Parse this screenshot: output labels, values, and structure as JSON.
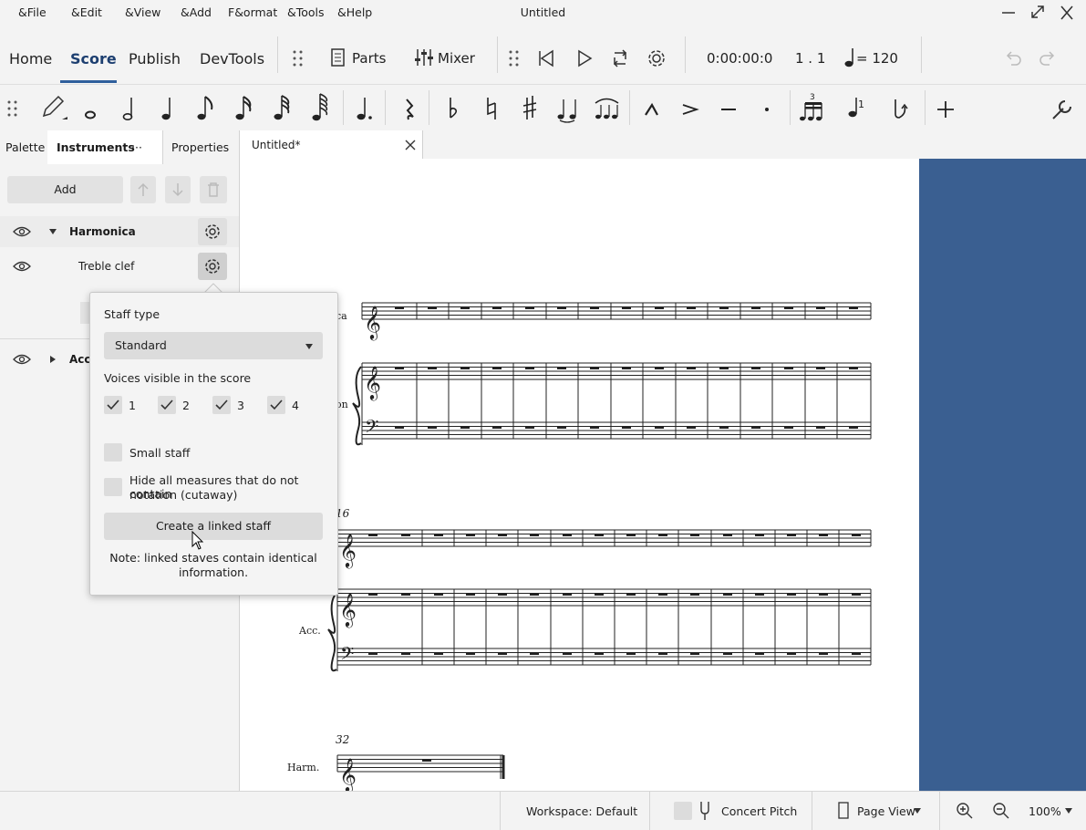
{
  "app": {
    "window_title": "Untitled",
    "menu": [
      "&File",
      "&Edit",
      "&View",
      "&Add",
      "F&ormat",
      "&Tools",
      "&Help"
    ]
  },
  "toolbar": {
    "tabs": [
      "Home",
      "Score",
      "Publish",
      "DevTools"
    ],
    "active_tab": "Score",
    "parts_label": "Parts",
    "mixer_label": "Mixer",
    "time": "0:00:00:0",
    "position": "1 . 1",
    "tempo": "= 120"
  },
  "note_input": {
    "icons": [
      "pencil-icon",
      "whole-note-icon",
      "half-note-icon",
      "quarter-note-icon",
      "eighth-note-icon",
      "16th-note-icon",
      "32nd-note-icon",
      "64th-note-icon",
      "dotted-note-icon",
      "rest-icon",
      "flat-icon",
      "natural-icon",
      "sharp-icon",
      "tie-icon",
      "slur-icon",
      "marcato-icon",
      "accent-icon",
      "tenuto-icon",
      "staccato-icon",
      "tuplet-icon",
      "voice-icon",
      "flip-icon",
      "add-icon",
      "customize-icon"
    ]
  },
  "panel": {
    "tabs": [
      "Palette",
      "Instruments",
      "Properties"
    ],
    "active_tab": "Instruments",
    "more_label": "···",
    "add_label": "Add",
    "instruments": [
      {
        "name": "Harmonica",
        "expanded": true,
        "staves": [
          "Treble clef"
        ]
      },
      {
        "name": "Acco",
        "expanded": false
      }
    ]
  },
  "popup": {
    "staff_type_label": "Staff type",
    "staff_type_value": "Standard",
    "voices_label": "Voices visible in the score",
    "voices": [
      {
        "label": "1",
        "checked": true
      },
      {
        "label": "2",
        "checked": true
      },
      {
        "label": "3",
        "checked": true
      },
      {
        "label": "4",
        "checked": true
      }
    ],
    "small_staff_label": "Small staff",
    "small_staff_checked": false,
    "hide_measures_label_1": "Hide all measures that do not contain",
    "hide_measures_label_2": "notation (cutaway)",
    "hide_measures_checked": false,
    "create_linked_label": "Create a linked staff",
    "note_line_1": "Note: linked staves contain identical",
    "note_line_2": "information."
  },
  "score": {
    "doc_tab": "Untitled*",
    "system1_labels": [
      "ca",
      "on"
    ],
    "system2_measure": "16",
    "system2_label": "Acc.",
    "system3_measure": "32",
    "system3_label": "Harm."
  },
  "statusbar": {
    "workspace": "Workspace: Default",
    "concert_pitch": "Concert Pitch",
    "concert_pitch_checked": false,
    "view_mode": "Page View",
    "zoom": "100%"
  },
  "colors": {
    "accent": "#2f5f9c",
    "page_edge": "#3a5f91",
    "panel_bg": "#f3f3f3"
  }
}
